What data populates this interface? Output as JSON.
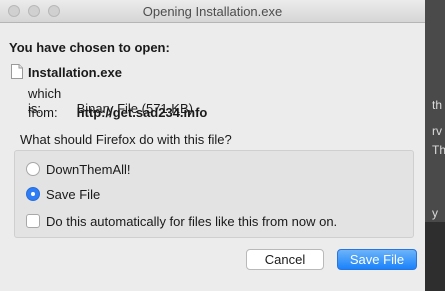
{
  "window": {
    "title": "Opening Installation.exe"
  },
  "dialog": {
    "heading": "You have chosen to open:",
    "file_icon": "document-icon",
    "file_name": "Installation.exe",
    "which_is_label": "which is:",
    "which_is_value": "Binary File (571 KB)",
    "from_label": "from:",
    "from_value": "http://get.sad234.info",
    "question": "What should Firefox do with this file?",
    "options": [
      {
        "label": "DownThemAll!",
        "selected": false
      },
      {
        "label": "Save File",
        "selected": true
      }
    ],
    "auto_checkbox_label": "Do this automatically for files like this from now on.",
    "auto_checked": false,
    "cancel_label": "Cancel",
    "save_label": "Save File"
  },
  "background": {
    "text_fragments": [
      "th",
      "rv",
      "Th",
      "y"
    ]
  },
  "colors": {
    "accent": "#2e7cf6",
    "button_blue": "#1a82fb"
  }
}
